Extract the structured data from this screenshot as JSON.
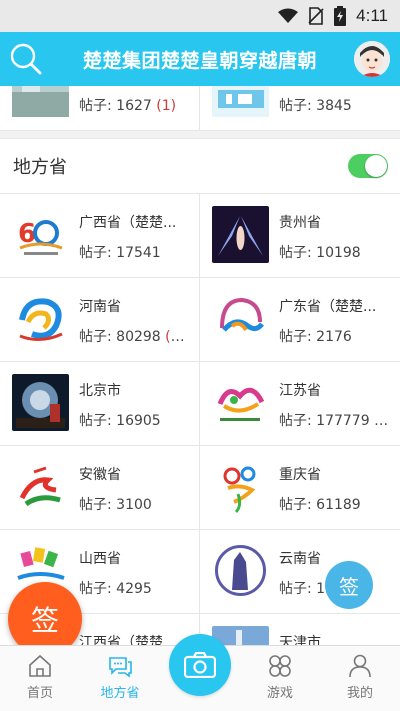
{
  "status": {
    "time": "4:11"
  },
  "header": {
    "title": "楚楚集团楚楚皇朝穿越唐朝"
  },
  "top_row": [
    {
      "posts_label": "帖子: 1627",
      "new_count": "(1)"
    },
    {
      "posts_label": "帖子: 3845",
      "new_count": ""
    }
  ],
  "section": {
    "title": "地方省",
    "toggle_on": true
  },
  "items": [
    {
      "name": "广西省（楚楚...",
      "posts_label": "帖子: 17541",
      "new_count": ""
    },
    {
      "name": "贵州省",
      "posts_label": "帖子: 10198",
      "new_count": ""
    },
    {
      "name": "河南省",
      "posts_label": "帖子: 80298",
      "new_count": "(5..."
    },
    {
      "name": "广东省（楚楚...",
      "posts_label": "帖子: 2176",
      "new_count": ""
    },
    {
      "name": "北京市",
      "posts_label": "帖子: 16905",
      "new_count": ""
    },
    {
      "name": "江苏省",
      "posts_label": "帖子: 177779",
      "new_count": "(..."
    },
    {
      "name": "安徽省",
      "posts_label": "帖子: 3100",
      "new_count": ""
    },
    {
      "name": "重庆省",
      "posts_label": "帖子: 61189",
      "new_count": ""
    },
    {
      "name": "山西省",
      "posts_label": "帖子: 4295",
      "new_count": ""
    },
    {
      "name": "云南省",
      "posts_label": "帖子: 1",
      "new_count": ""
    },
    {
      "name": "江西省（楚楚",
      "posts_label": "",
      "new_count": ""
    },
    {
      "name": "天津市",
      "posts_label": "",
      "new_count": ""
    }
  ],
  "fab": {
    "left_label": "签",
    "right_label": "签"
  },
  "tabs": [
    {
      "label": "首页"
    },
    {
      "label": "地方省"
    },
    {
      "label": ""
    },
    {
      "label": "游戏"
    },
    {
      "label": "我的"
    }
  ],
  "colors": {
    "accent": "#29c6f0",
    "fab": "#ff5e1f",
    "new_count": "#d03a3a",
    "toggle": "#4ccf60"
  }
}
